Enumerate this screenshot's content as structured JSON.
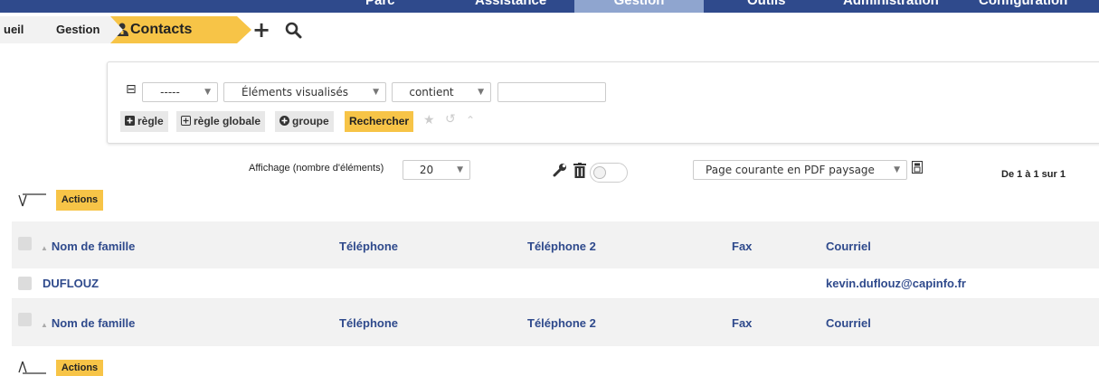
{
  "topnav": {
    "tabs": [
      {
        "label": "Parc"
      },
      {
        "label": "Assistance"
      },
      {
        "label": "Gestion",
        "active": true
      },
      {
        "label": "Outils"
      },
      {
        "label": "Administration"
      },
      {
        "label": "Configuration"
      }
    ]
  },
  "breadcrumb": {
    "home": "ueil",
    "gestion": "Gestion",
    "contacts": "Contacts",
    "add_glyph": "+",
    "search_glyph": "⚲"
  },
  "search": {
    "minus_glyph": "⊟",
    "field1": "-----",
    "field2": "Éléments visualisés",
    "field3": "contient",
    "value": "",
    "btn_rule": "règle",
    "btn_global_rule": "règle globale",
    "btn_group": "groupe",
    "btn_search": "Rechercher",
    "star_glyph": "★",
    "undo_glyph": "↺",
    "collapse_glyph": "⌃"
  },
  "toolbar": {
    "display_label": "Affichage (nombre d'éléments)",
    "display_value": "20",
    "export_value": "Page courante en PDF paysage",
    "pager": "De 1 à 1 sur 1",
    "actions_label": "Actions"
  },
  "table": {
    "columns": [
      "Nom de famille",
      "Téléphone",
      "Téléphone 2",
      "Fax",
      "Courriel"
    ],
    "rows": [
      {
        "nom": "DUFLOUZ",
        "telephone": "",
        "telephone2": "",
        "fax": "",
        "courriel": "kevin.duflouz@capinfo.fr"
      }
    ]
  },
  "colors": {
    "nav": "#2f4a8c",
    "accent": "#f7c447",
    "link": "#2f4a8c"
  }
}
